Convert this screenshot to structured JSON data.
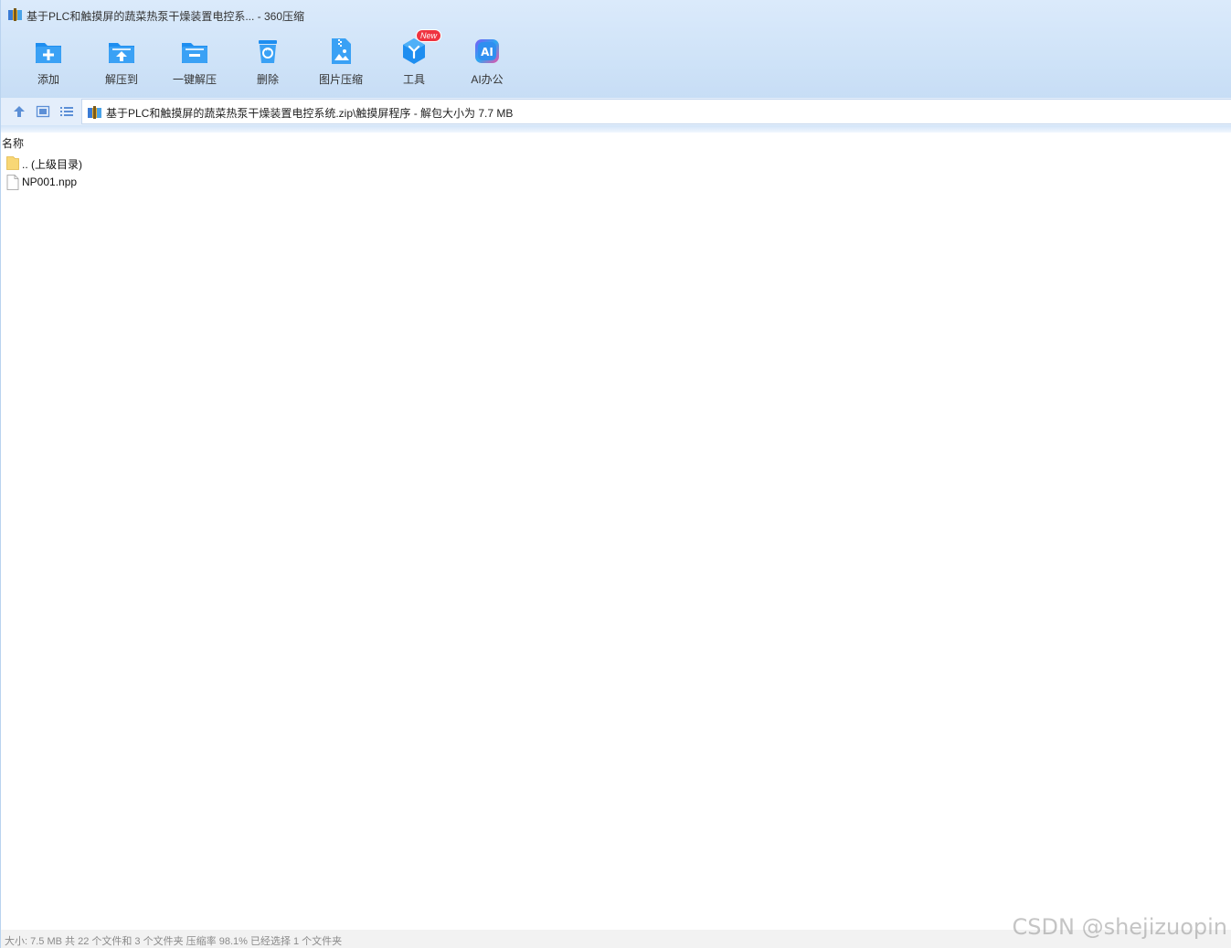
{
  "window": {
    "title": "基于PLC和触摸屏的蔬菜热泵干燥装置电控系... - 360压缩"
  },
  "toolbar": {
    "items": [
      {
        "label": "添加",
        "icon": "add-folder-icon"
      },
      {
        "label": "解压到",
        "icon": "extract-to-icon"
      },
      {
        "label": "一键解压",
        "icon": "one-click-extract-icon"
      },
      {
        "label": "删除",
        "icon": "delete-icon"
      },
      {
        "label": "图片压缩",
        "icon": "image-compress-icon"
      },
      {
        "label": "工具",
        "icon": "tools-icon",
        "badge": "New"
      },
      {
        "label": "AI办公",
        "icon": "ai-office-icon"
      }
    ]
  },
  "addressbar": {
    "path": "基于PLC和触摸屏的蔬菜热泵干燥装置电控系统.zip\\触摸屏程序 - 解包大小为 7.7 MB"
  },
  "filelist": {
    "column_name": "名称",
    "rows": [
      {
        "name": ".. (上级目录)",
        "type": "parent-folder"
      },
      {
        "name": "NP001.npp",
        "type": "file"
      }
    ]
  },
  "statusbar": {
    "text": "大小: 7.5 MB 共 22 个文件和 3 个文件夹 压缩率 98.1% 已经选择 1 个文件夹"
  },
  "watermark": "CSDN @shejizuopin",
  "colors": {
    "accent": "#1e8ef0",
    "header_bg": "#d3e5f9",
    "badge_red": "#ef3340"
  }
}
